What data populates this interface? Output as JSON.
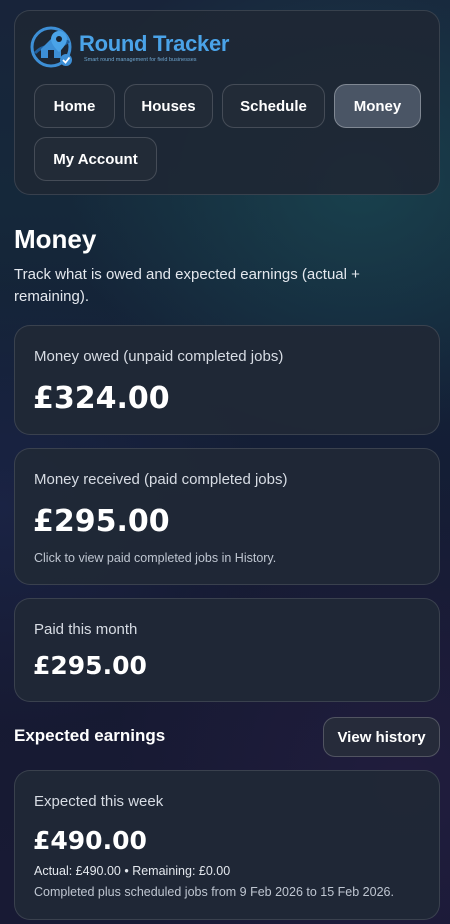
{
  "brand": {
    "name": "Round Tracker",
    "tagline": "Smart round management for field businesses"
  },
  "nav": {
    "home": "Home",
    "houses": "Houses",
    "schedule": "Schedule",
    "money": "Money",
    "account": "My Account",
    "active": "Money"
  },
  "page": {
    "title": "Money",
    "subtitle": "Track what is owed and expected earnings (actual + remaining)."
  },
  "owed": {
    "label": "Money owed (unpaid completed jobs)",
    "value": "£324.00"
  },
  "received": {
    "label": "Money received (paid completed jobs)",
    "value": "£295.00",
    "note": "Click to view paid completed jobs in History."
  },
  "month": {
    "label": "Paid this month",
    "value": "£295.00"
  },
  "expected": {
    "section_title": "Expected earnings",
    "history_button": "View history",
    "week_label": "Expected this week",
    "week_value": "£490.00",
    "breakdown": "Actual: £490.00 • Remaining: £0.00",
    "range_note": "Completed plus scheduled jobs from 9 Feb 2026 to 15 Feb 2026."
  },
  "colors": {
    "brand_blue": "#4aa3e8",
    "active_tab": "#4a5565",
    "card_bg": "#202836"
  },
  "icons": {
    "logo": "house-location-logo-icon"
  }
}
